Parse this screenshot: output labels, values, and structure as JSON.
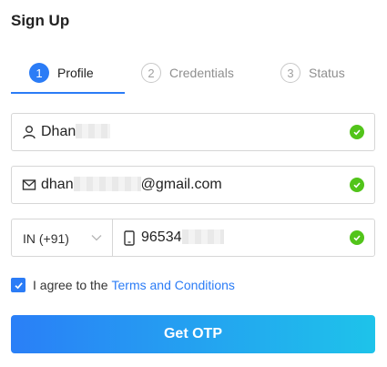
{
  "page": {
    "title": "Sign Up"
  },
  "steps": [
    {
      "number": "1",
      "label": "Profile",
      "state": "active"
    },
    {
      "number": "2",
      "label": "Credentials",
      "state": "inactive"
    },
    {
      "number": "3",
      "label": "Status",
      "state": "inactive"
    }
  ],
  "form": {
    "name": {
      "value": "Dhan",
      "icon": "user-icon",
      "valid": true
    },
    "email": {
      "value_prefix": "dhan",
      "value_suffix": "@gmail.com",
      "icon": "mail-icon",
      "valid": true
    },
    "country_code": {
      "value": "IN (+91)",
      "icon": "chevron-down-icon"
    },
    "phone": {
      "value": "96534",
      "icon": "mobile-phone-icon",
      "valid": true
    }
  },
  "agreement": {
    "checked": true,
    "text": "I agree to the",
    "link_text": "Terms and Conditions"
  },
  "submit": {
    "label": "Get OTP"
  },
  "colors": {
    "accent": "#2b7cf6",
    "success": "#52c41a",
    "gradient_end": "#1ec3ea"
  }
}
